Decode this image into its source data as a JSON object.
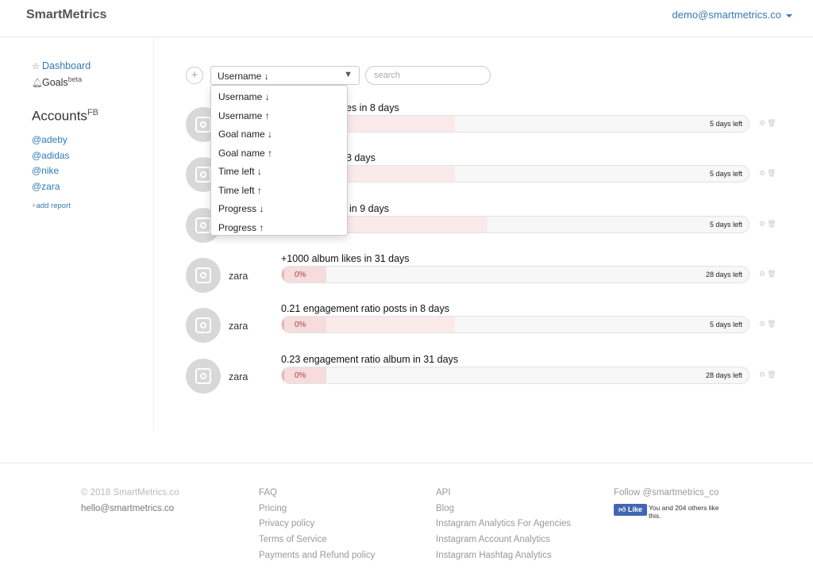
{
  "header": {
    "brand": "SmartMetrics",
    "user_email": "demo@smartmetrics.co"
  },
  "sidebar": {
    "dashboard_label": "Dashboard",
    "goals_label": "Goals",
    "goals_badge": "beta",
    "accounts_title": "Accounts",
    "accounts_badge": "FB",
    "accounts": [
      "@adeby",
      "@adidas",
      "@nike",
      "@zara"
    ],
    "add_report_label": "add report"
  },
  "toolbar": {
    "add_symbol": "+",
    "sort_selected": "Username ↓",
    "search_placeholder": "search"
  },
  "sort_options": [
    "Username ↓",
    "Username ↑",
    "Goal name ↓",
    "Goal name ↑",
    "Time left ↓",
    "Time left ↑",
    "Progress ↓",
    "Progress ↑"
  ],
  "goals": [
    {
      "user": "",
      "title_visible": "es in 8 days",
      "progress_label": "",
      "progress_fraction": 0.37,
      "time_left": "5 days left"
    },
    {
      "user": "",
      "title_visible": "8 days",
      "progress_label": "",
      "progress_fraction": 0.37,
      "time_left": "5 days left"
    },
    {
      "user": "",
      "title_visible": "in 9 days",
      "progress_label": "",
      "progress_fraction": 0.44,
      "time_left": "5 days left"
    },
    {
      "user": "zara",
      "title_visible": "+1000 album likes in 31 days",
      "progress_label": "0%",
      "progress_fraction": 0.0,
      "time_left": "28 days left"
    },
    {
      "user": "zara",
      "title_visible": "0.21 engagement ratio posts in 8 days",
      "progress_label": "0%",
      "progress_fraction": 0.37,
      "time_left": "5 days left"
    },
    {
      "user": "zara",
      "title_visible": "0.23 engagement ratio album in 31 days",
      "progress_label": "0%",
      "progress_fraction": 0.0,
      "time_left": "28 days left"
    }
  ],
  "footer": {
    "col1": [
      "© 2018 SmartMetrics.co",
      "hello@smartmetrics.co"
    ],
    "col2": [
      "FAQ",
      "Pricing",
      "Privacy policy",
      "Terms of Service",
      "Payments and Refund policy"
    ],
    "col3": [
      "API",
      "Blog",
      "Instagram Analytics For Agencies",
      "Instagram Account Analytics",
      "Instagram Hashtag Analytics"
    ],
    "follow_label": "Follow @smartmetrics_co",
    "like_button": "Like",
    "like_text": "You and 204 others like this."
  }
}
